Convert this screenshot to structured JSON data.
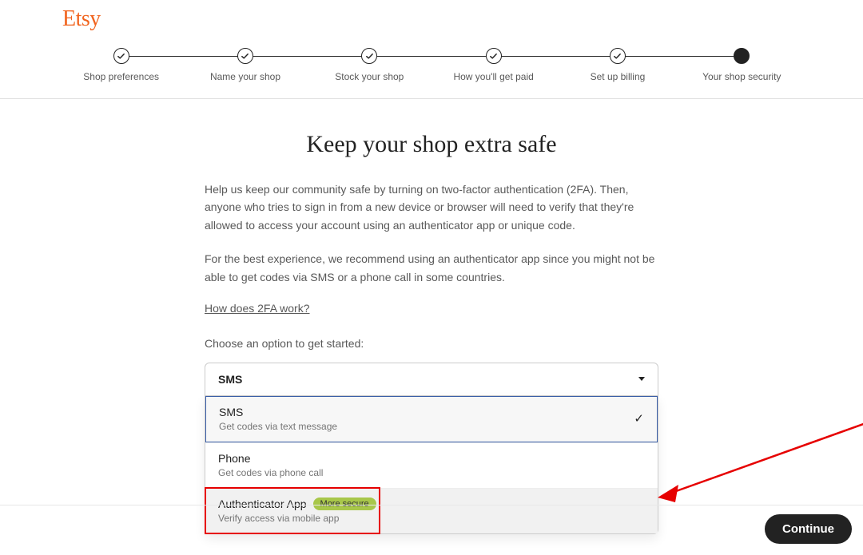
{
  "brand": "Etsy",
  "steps": [
    {
      "label": "Shop preferences",
      "state": "done"
    },
    {
      "label": "Name your shop",
      "state": "done"
    },
    {
      "label": "Stock your shop",
      "state": "done"
    },
    {
      "label": "How you'll get paid",
      "state": "done"
    },
    {
      "label": "Set up billing",
      "state": "done"
    },
    {
      "label": "Your shop security",
      "state": "current"
    }
  ],
  "title": "Keep your shop extra safe",
  "intro1": "Help us keep our community safe by turning on two-factor authentication (2FA). Then, anyone who tries to sign in from a new device or browser will need to verify that they're allowed to access your account using an authenticator app or unique code.",
  "intro2": "For the best experience, we recommend using an authenticator app since you might not be able to get codes via SMS or a phone call in some countries.",
  "link": "How does 2FA work?",
  "choose_label": "Choose an option to get started:",
  "select": {
    "current": "SMS",
    "options": [
      {
        "title": "SMS",
        "desc": "Get codes via text message",
        "selected": true
      },
      {
        "title": "Phone",
        "desc": "Get codes via phone call"
      },
      {
        "title": "Authenticator App",
        "desc": "Verify access via mobile app",
        "badge": "More secure",
        "highlight": true
      }
    ]
  },
  "continue": "Continue"
}
